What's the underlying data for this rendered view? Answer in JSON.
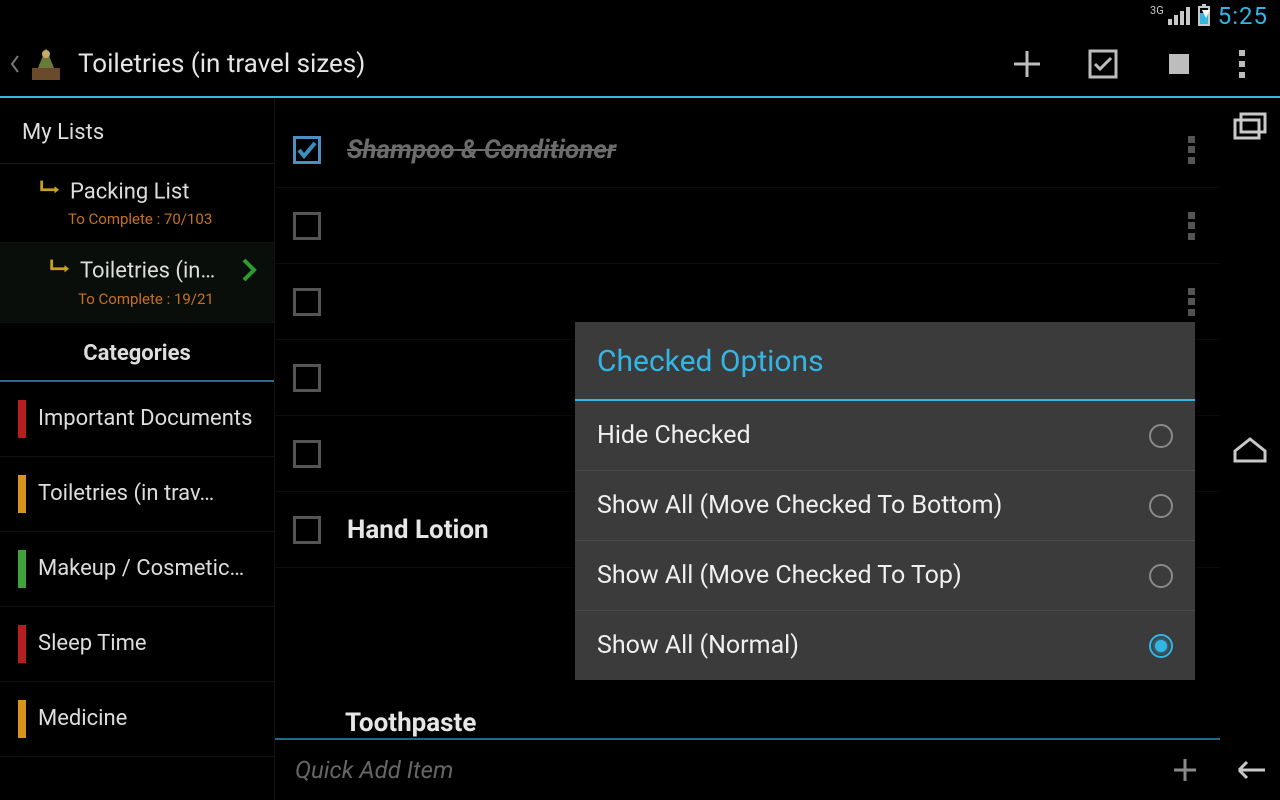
{
  "status": {
    "network": "3G",
    "clock": "5:25"
  },
  "actionbar": {
    "title": "Toiletries (in travel sizes)"
  },
  "sidebar": {
    "header": "My Lists",
    "lists": [
      {
        "label": "Packing List",
        "sub_prefix": "To Complete : ",
        "sub_count": "70/103"
      },
      {
        "label": "Toiletries (in…",
        "sub_prefix": "To Complete : ",
        "sub_count": "19/21"
      }
    ],
    "categories_header": "Categories",
    "categories": [
      {
        "label": "Important Documents",
        "color": "#b51f1f"
      },
      {
        "label": "Toiletries (in trav…",
        "color": "#d6951a",
        "active": true
      },
      {
        "label": "Makeup / Cosmetic…",
        "color": "#3fa23a"
      },
      {
        "label": "Sleep Time",
        "color": "#b51f1f"
      },
      {
        "label": "Medicine",
        "color": "#d6951a"
      }
    ]
  },
  "list": {
    "items": [
      {
        "label": "Shampoo & Conditioner",
        "checked": true
      },
      {
        "label": "",
        "checked": false
      },
      {
        "label": "",
        "checked": false
      },
      {
        "label": "",
        "checked": false
      },
      {
        "label": "",
        "checked": false
      },
      {
        "label": "Hand Lotion",
        "checked": false,
        "plain": true
      }
    ],
    "cutoff": "Toothpaste",
    "quick_add_placeholder": "Quick Add Item"
  },
  "dialog": {
    "title": "Checked Options",
    "options": [
      {
        "label": "Hide Checked",
        "selected": false
      },
      {
        "label": "Show All (Move Checked To Bottom)",
        "selected": false
      },
      {
        "label": "Show All (Move Checked To Top)",
        "selected": false
      },
      {
        "label": "Show All (Normal)",
        "selected": true
      }
    ]
  }
}
